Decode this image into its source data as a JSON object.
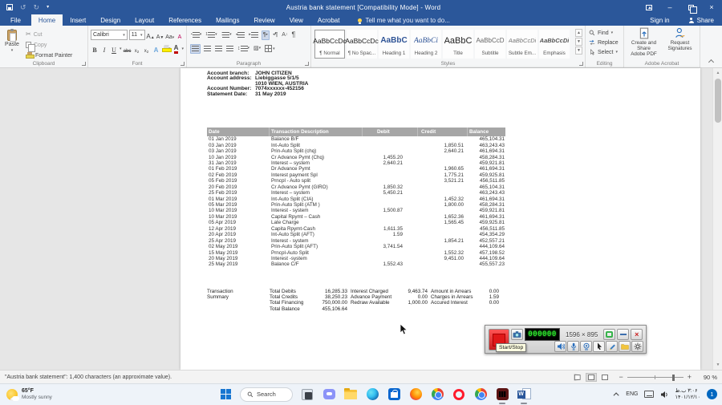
{
  "colors": {
    "accent": "#2b579a",
    "table_header_bg": "#a6a6a6",
    "record_red": "#e01818",
    "timer_green": "#33ff33",
    "badge_blue": "#0067c0"
  },
  "icons": {
    "save": "floppy-disk",
    "undo": "↺",
    "redo": "↻",
    "dropdown": "▾",
    "minimize": "–",
    "close": "×",
    "scissors": "✂",
    "pilcrow": "¶",
    "search": "magnifier"
  },
  "window": {
    "title": "Austria bank statement [Compatibility Mode] - Word"
  },
  "tabs": {
    "file": "File",
    "items": [
      "Home",
      "Insert",
      "Design",
      "Layout",
      "References",
      "Mailings",
      "Review",
      "View",
      "Acrobat"
    ],
    "active": "Home",
    "tell_me": "Tell me what you want to do...",
    "sign_in": "Sign in",
    "share": "Share"
  },
  "ribbon": {
    "clipboard": {
      "label": "Clipboard",
      "paste": "Paste",
      "cut": "Cut",
      "copy": "Copy",
      "format_painter": "Format Painter"
    },
    "font": {
      "label": "Font",
      "name": "Calibri",
      "size": "11",
      "bold": "B",
      "italic": "I",
      "underline": "U",
      "strike": "abc",
      "case": "Aa",
      "effects": "A",
      "color": "A"
    },
    "paragraph": {
      "label": "Paragraph"
    },
    "styles": {
      "label": "Styles",
      "items": [
        {
          "preview": "AaBbCcDc",
          "name": "¶ Normal"
        },
        {
          "preview": "AaBbCcDc",
          "name": "¶ No Spac..."
        },
        {
          "preview": "AaBbC",
          "name": "Heading 1"
        },
        {
          "preview": "AaBbCi",
          "name": "Heading 2"
        },
        {
          "preview": "AaBbC",
          "name": "Title"
        },
        {
          "preview": "AaBbCcD",
          "name": "Subtitle"
        },
        {
          "preview": "AaBbCcDi",
          "name": "Subtle Em..."
        },
        {
          "preview": "AaBbCcDi",
          "name": "Emphasis"
        }
      ]
    },
    "editing": {
      "label": "Editing",
      "find": "Find",
      "replace": "Replace",
      "select": "Select"
    },
    "acrobat": {
      "label": "Adobe Acrobat",
      "create_line1": "Create and Share",
      "create_line2": "Adobe PDF",
      "request_line1": "Request",
      "request_line2": "Signatures"
    }
  },
  "document": {
    "account": [
      {
        "label": "Account branch:",
        "value": "JOHN CITIZEN"
      },
      {
        "label": "Account address:",
        "value": "Liebiggasse 5/1/5"
      },
      {
        "label": "",
        "value": "1010 WIEN, AUSTRIA"
      },
      {
        "label": "Account Number:",
        "value": "7074xxxxxx-452156"
      },
      {
        "label": "Statement Date:",
        "value": "31 May 2019"
      }
    ],
    "table": {
      "headers": [
        "Date",
        "Transaction Description",
        "Debit",
        "Credit",
        "Balance"
      ],
      "rows": [
        [
          "01 Jan 2019",
          "Balance B/F",
          "",
          "",
          "465,104.31"
        ],
        [
          "03 Jan 2019",
          "Int-Auto Split",
          "",
          "1,850.51",
          "463,243.43"
        ],
        [
          "03 Jan 2019",
          "Prin-Auto Split (chq)",
          "",
          "2,640.21",
          "461,694.31"
        ],
        [
          "10 Jan 2019",
          "Cr Advance Pymt (Chq)",
          "1,455.20",
          "",
          "458,284.31"
        ],
        [
          "31 Jan 2019",
          "Interest – system",
          "2,640.21",
          "",
          "459,921.81"
        ],
        [
          "01 Feb 2019",
          "Dr Advance Pymt",
          "",
          "1,960.65",
          "461,694.31"
        ],
        [
          "02 Feb 2019",
          "Interest payment Spl",
          "",
          "1,775.21",
          "459,925.81"
        ],
        [
          "05 Feb 2019",
          "Prncpl - Auto split",
          "",
          "3,521.21",
          "456,511.85"
        ],
        [
          "20 Feb 2019",
          "Cr Advance Pymt (GIRO)",
          "1,850.32",
          "",
          "465,104.31"
        ],
        [
          "25 Feb 2019",
          "Interest – system",
          "5,450.21",
          "",
          "463,243.43"
        ],
        [
          "01 Mar 2019",
          "Int-Auto Split (CIA)",
          "",
          "1,452.32",
          "461,694.31"
        ],
        [
          "05 Mar 2019",
          "Prin-Auto Split (ATM )",
          "",
          "1,800.00",
          "458,284.31"
        ],
        [
          "10 Mar 2019",
          "Interest - system",
          "1,500.87",
          "",
          "459,921.81"
        ],
        [
          "10 Mar 2019",
          "Capital Rpymt – Cash",
          "",
          "1,652.36",
          "461,694.31"
        ],
        [
          "05 Apr 2019",
          "Late Charge",
          "",
          "1,565.45",
          "459,925.81"
        ],
        [
          "12 Apr 2019",
          "Capita Rpymt-Cash",
          "1,611.35",
          "",
          "456,511.85"
        ],
        [
          "20 Apr 2019",
          "Int-Auto Split (AFT)",
          "1.59",
          "",
          "454,354.29"
        ],
        [
          "25 Apr 2019",
          "Interest - system",
          "",
          "1,854.21",
          "452,557.21"
        ],
        [
          "02 May 2019",
          "Prin-Auto Split (AFT)",
          "3,741.54",
          "",
          "444,109.64"
        ],
        [
          "15 May 2019",
          "Prncpl-Auto Split",
          "",
          "1,552.32",
          "457,198.52"
        ],
        [
          "20 May 2019",
          "Interest -system",
          "",
          "9,451.00",
          "444,109.64"
        ],
        [
          "25 May 2019",
          "Balance C/F",
          "1,552.43",
          "",
          "455,557.23"
        ]
      ]
    },
    "summary": {
      "title_line1": "Transaction",
      "title_line2": "Summary",
      "col1": [
        {
          "label": "Total Debits",
          "value": "16,285.33"
        },
        {
          "label": "Total Credits",
          "value": "38,250.23"
        },
        {
          "label": "Total Financing",
          "value": "750,000.00"
        },
        {
          "label": "Total Balance",
          "value": "455,106.64"
        }
      ],
      "col2": [
        {
          "label": "Interest Charged",
          "value": "9,463.74"
        },
        {
          "label": "Advance Payment",
          "value": "0.00"
        },
        {
          "label": "Redraw Available",
          "value": "1,000.00"
        }
      ],
      "col3": [
        {
          "label": "Amount in Arrears",
          "value": "0.00"
        },
        {
          "label": "Charges in Arrears",
          "value": "1.59"
        },
        {
          "label": "Accured Interest",
          "value": "0.00"
        }
      ]
    }
  },
  "recorder": {
    "tooltip": "Start/Stop",
    "timer": "000000",
    "resolution": "1596 × 895"
  },
  "status": {
    "message": "\"Austria bank statement\": 1,400 characters (an approximate value).",
    "zoom_level": "90 %"
  },
  "taskbar": {
    "weather": {
      "temp": "65°F",
      "condition": "Mostly sunny"
    },
    "search_label": "Search",
    "tray": {
      "lang": "ENG",
      "time": "۳:۰۶ ب.ظ",
      "date": "۱۴۰۱/۱۲/۱۰",
      "badge": "1"
    }
  }
}
